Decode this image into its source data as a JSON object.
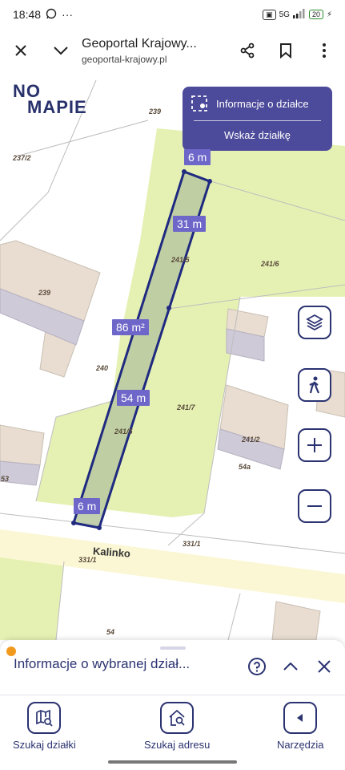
{
  "status": {
    "time": "18:48",
    "network": "5G",
    "battery": "20",
    "menu_dots": "···"
  },
  "browser": {
    "title": "Geoportal Krajowy...",
    "url": "geoportal-krajowy.pl"
  },
  "map": {
    "logo_line1": "NO",
    "logo_line2": "MAPIE",
    "info_panel": {
      "parcel_info_label": "Informacje o działce",
      "point_parcel_label": "Wskaż działkę"
    },
    "measurements": {
      "top": "6 m",
      "right_upper": "31 m",
      "area": "86 m²",
      "left_lower": "54 m",
      "bottom": "6 m"
    },
    "parcel_labels": [
      "239",
      "240",
      "237/2",
      "241/6",
      "241/5",
      "241/5",
      "241/7",
      "241/2",
      "54a",
      "53",
      "331/1",
      "331/1",
      "54",
      "240",
      "239"
    ],
    "street_name": "Kalinko"
  },
  "sheet": {
    "title": "Informacje o wybranej dział..."
  },
  "nav": {
    "search_parcel": "Szukaj działki",
    "search_address": "Szukaj adresu",
    "tools": "Narzędzia"
  },
  "colors": {
    "brand": "#2b3371",
    "accent": "#6e67c9",
    "parcel_fill": "#e5f1b3",
    "building": "#e8ddd0"
  }
}
